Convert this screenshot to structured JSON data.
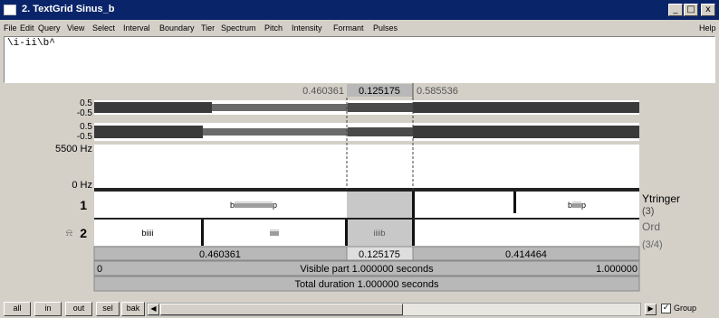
{
  "window": {
    "title": "2. TextGrid Sinus_b",
    "controls": [
      "_",
      "□",
      "x"
    ]
  },
  "menu": {
    "items": [
      "File",
      "Edit",
      "Query",
      "View",
      "Select",
      "Interval",
      "Boundary",
      "Tier",
      "Spectrum",
      "Pitch",
      "Intensity",
      "Formant",
      "Pulses"
    ],
    "help": "Help"
  },
  "text_field": {
    "value": "\\i-ii\\b^"
  },
  "selection": {
    "start": "0.460361",
    "duration": "0.125175",
    "end": "0.585536"
  },
  "waveform": {
    "channel1_top": "0.5",
    "channel1_bottom": "-0.5",
    "channel2_top": "0.5",
    "channel2_bottom": "-0.5"
  },
  "spectrogram": {
    "max_label": "5500 Hz",
    "min_label": "0 Hz"
  },
  "tiers": [
    {
      "number": "1",
      "name": "Ytringer",
      "count": "(3)",
      "intervals": [
        "biiiiiiiiiiiiiiiiiiiiip",
        "",
        "biiiiip"
      ]
    },
    {
      "number": "2",
      "name": "Ord",
      "count": "(3/4)",
      "intervals": [
        "biiii",
        "iiiii",
        "iiiib",
        ""
      ]
    }
  ],
  "bottom_rows": {
    "left_duration": "0.460361",
    "selected_duration": "0.125175",
    "right_duration": "0.414464",
    "visible_start": "0",
    "visible_text": "Visible part 1.000000 seconds",
    "visible_end": "1.000000",
    "total_text": "Total duration 1.000000 seconds"
  },
  "buttons": [
    "all",
    "in",
    "out",
    "sel",
    "bak"
  ],
  "group": {
    "label": "Group",
    "checked": true
  }
}
